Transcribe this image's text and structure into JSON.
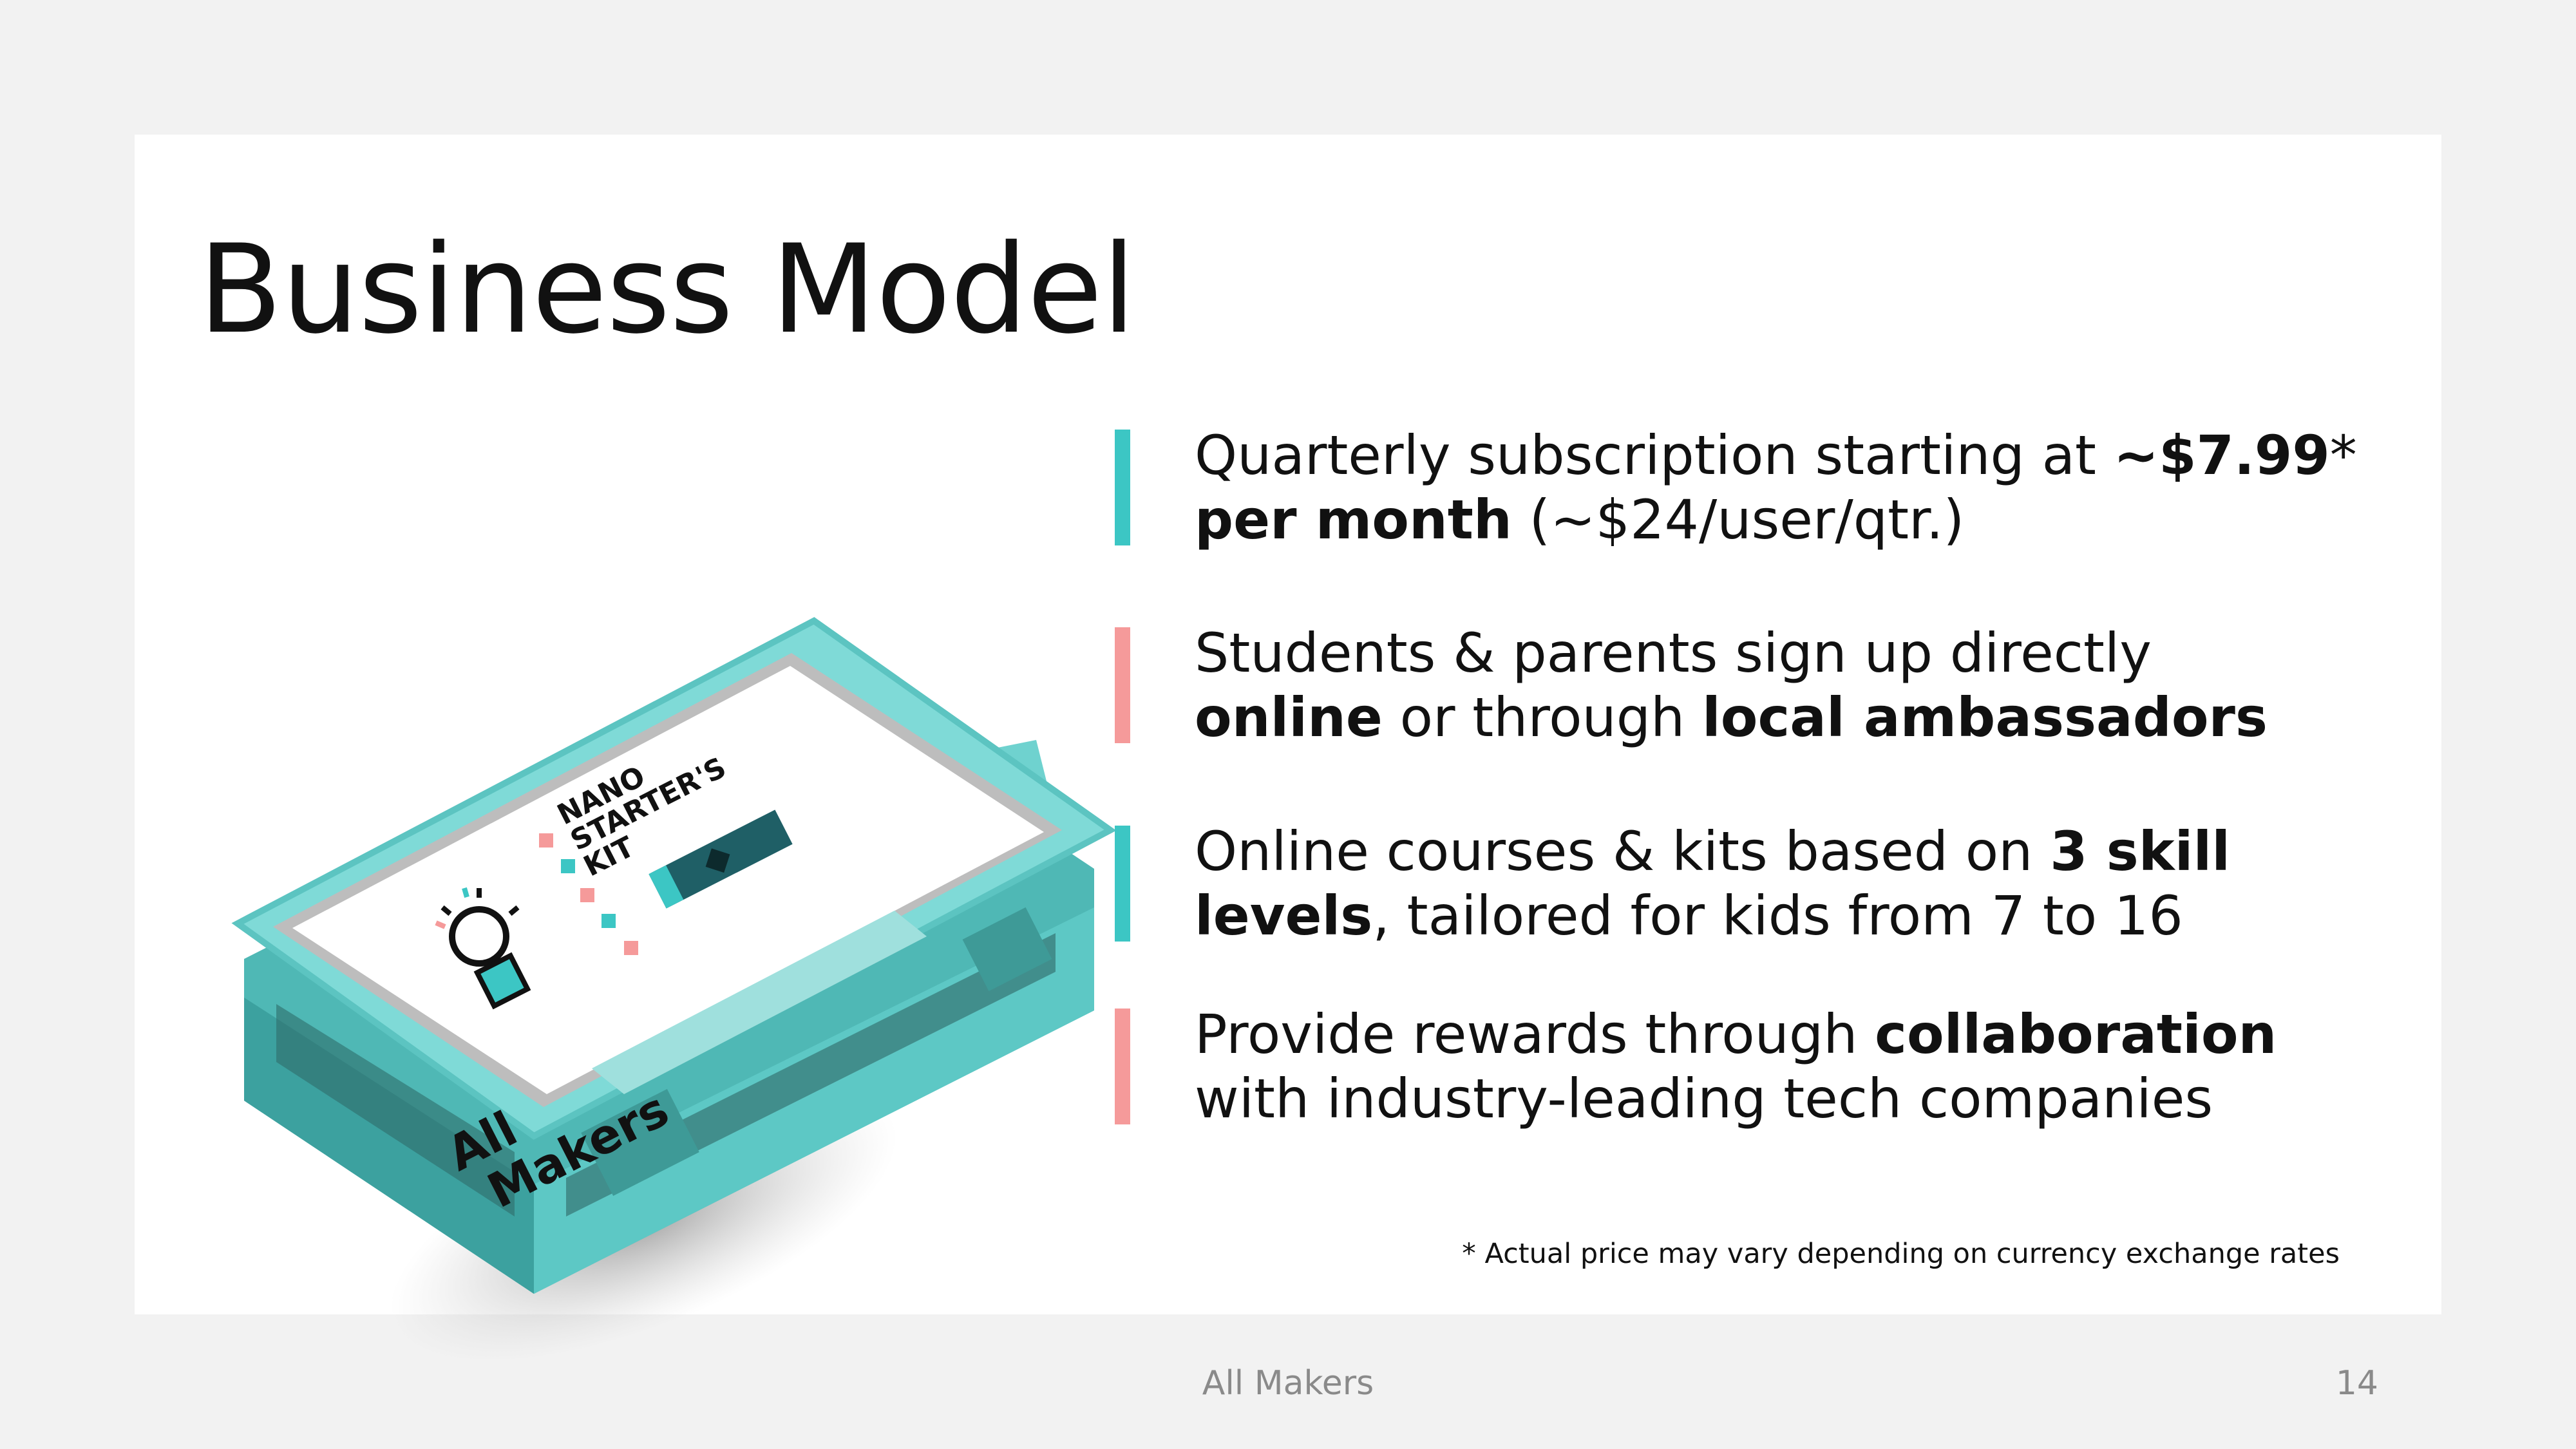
{
  "slide": {
    "title": "Business Model",
    "kit_image": {
      "label_line1": "NANO",
      "label_line2": "STARTER'S",
      "label_line3": "KIT",
      "brand_line1": "All",
      "brand_line2": "Makers"
    },
    "bullets": [
      {
        "color": "#3cc6c4",
        "line1_pre": "Quarterly subscription starting at ",
        "line1_bold": "~$7.99",
        "line1_post": "*",
        "line2_bold": "per month",
        "line2_post": " (~$24/user/qtr.)"
      },
      {
        "color": "#f59a9a",
        "line1_pre": "Students & parents sign up directly",
        "line2_bold": "online",
        "line2_mid": " or through ",
        "line2_bold2": "local ambassadors"
      },
      {
        "color": "#3cc6c4",
        "line1_pre": "Online courses & kits based on ",
        "line1_bold": "3 skill",
        "line2_bold": "levels",
        "line2_post": ", tailored for kids from 7 to 16"
      },
      {
        "color": "#f59a9a",
        "line1_pre": "Provide rewards through ",
        "line1_bold": "collaboration",
        "line2_post": "with industry-leading tech companies"
      }
    ],
    "footnote": "* Actual price may vary depending on currency exchange rates"
  },
  "footer": {
    "center_text": "All Makers",
    "page_number": "14"
  }
}
